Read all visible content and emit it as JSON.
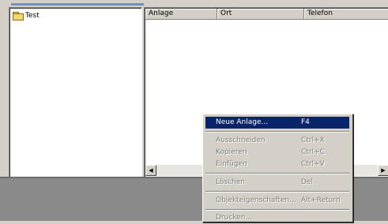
{
  "tree": {
    "item_label": "Test"
  },
  "list": {
    "columns": [
      "Anlage",
      "Ort",
      "Telefon"
    ]
  },
  "context_menu": {
    "items": [
      {
        "label": "Neue Anlage...",
        "shortcut": "F4",
        "state": "highlighted"
      },
      {
        "label": "Ausschneiden",
        "shortcut": "Ctrl+X",
        "state": "disabled"
      },
      {
        "label": "Kopieren",
        "shortcut": "Ctrl+C",
        "state": "disabled"
      },
      {
        "label": "Einfügen",
        "shortcut": "Ctrl+V",
        "state": "disabled"
      },
      {
        "label": "Löschen",
        "shortcut": "Del",
        "state": "disabled"
      },
      {
        "label": "Objekteigenschaften...",
        "shortcut": "Alt+Return",
        "state": "disabled"
      },
      {
        "label": "Drucken...",
        "shortcut": "",
        "state": "disabled"
      }
    ]
  },
  "colors": {
    "highlight": "#0a246a",
    "window_face": "#d4d0c8",
    "workspace": "#8a8a8a"
  }
}
